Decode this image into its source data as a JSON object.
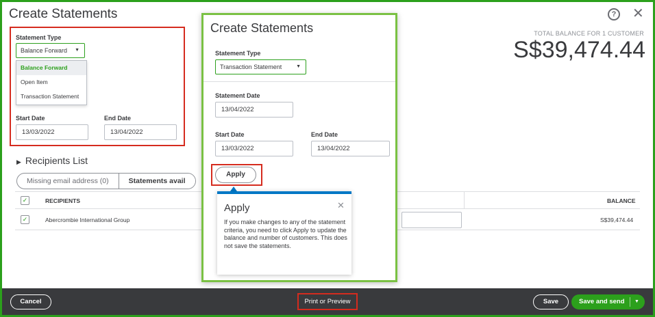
{
  "main": {
    "title": "Create Statements",
    "total_label": "TOTAL BALANCE FOR 1 CUSTOMER",
    "total_value": "S$39,474.44",
    "statement_type_label": "Statement Type",
    "statement_type_value": "Balance Forward",
    "statement_type_options": [
      "Balance Forward",
      "Open Item",
      "Transaction Statement"
    ],
    "start_date_label": "Start Date",
    "start_date_value": "13/03/2022",
    "end_date_label": "End Date",
    "end_date_value": "13/04/2022",
    "recipients_title": "Recipients List",
    "segment_tabs": [
      "Missing email address (0)",
      "Statements avail"
    ],
    "table": {
      "col_recipients": "RECIPIENTS",
      "col_balance": "BALANCE",
      "rows": [
        {
          "name": "Abercrombie International Group",
          "balance": "S$39,474.44"
        }
      ]
    }
  },
  "dialog": {
    "title": "Create Statements",
    "statement_type_label": "Statement Type",
    "statement_type_value": "Transaction Statement",
    "statement_date_label": "Statement Date",
    "statement_date_value": "13/04/2022",
    "start_date_label": "Start Date",
    "start_date_value": "13/03/2022",
    "end_date_label": "End Date",
    "end_date_value": "13/04/2022",
    "apply_label": "Apply"
  },
  "tooltip": {
    "title": "Apply",
    "body": "If you make changes to any of the statement criteria, you need to click Apply to update the balance and number of customers. This does not save the statements."
  },
  "footer": {
    "cancel_label": "Cancel",
    "print_label": "Print or Preview",
    "save_label": "Save",
    "save_send_label": "Save and send"
  },
  "icons": {
    "help": "help-circle-icon",
    "close": "close-icon",
    "caret": "caret-down-icon",
    "expand": "triangle-right-icon",
    "check": "checkmark-icon"
  },
  "colors": {
    "brand_green": "#2ca01c",
    "highlight_red": "#d52b1e",
    "dialog_border": "#7ac143",
    "tooltip_blue": "#0077c5",
    "footer_dark": "#393a3d"
  }
}
